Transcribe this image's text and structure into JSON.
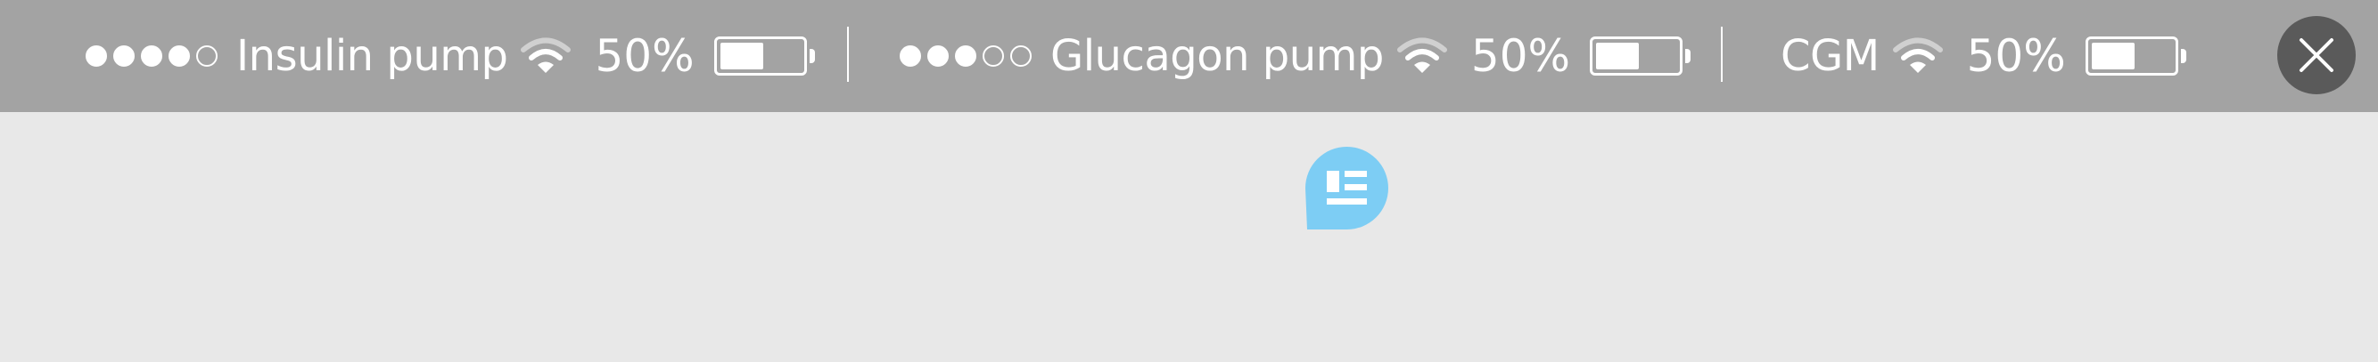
{
  "status_bar": {
    "devices": [
      {
        "name": "Insulin pump",
        "signal_strength": 4,
        "signal_max": 5,
        "battery_percent": "50%",
        "battery_level": 0.5
      },
      {
        "name": "Glucagon pump",
        "signal_strength": 3,
        "signal_max": 5,
        "battery_percent": "50%",
        "battery_level": 0.5
      },
      {
        "name": "CGM",
        "signal_strength": null,
        "signal_max": null,
        "battery_percent": "50%",
        "battery_level": 0.5
      }
    ],
    "close_icon": "close-x-icon"
  },
  "chat_button": {
    "icon": "chat-bubble-list-icon",
    "color": "#7dcdf4"
  },
  "colors": {
    "status_bar_bg": "#a3a3a3",
    "page_bg": "#e8e8e8",
    "close_button_bg": "#5a5a5a",
    "foreground": "#ffffff",
    "accent": "#7dcdf4"
  }
}
